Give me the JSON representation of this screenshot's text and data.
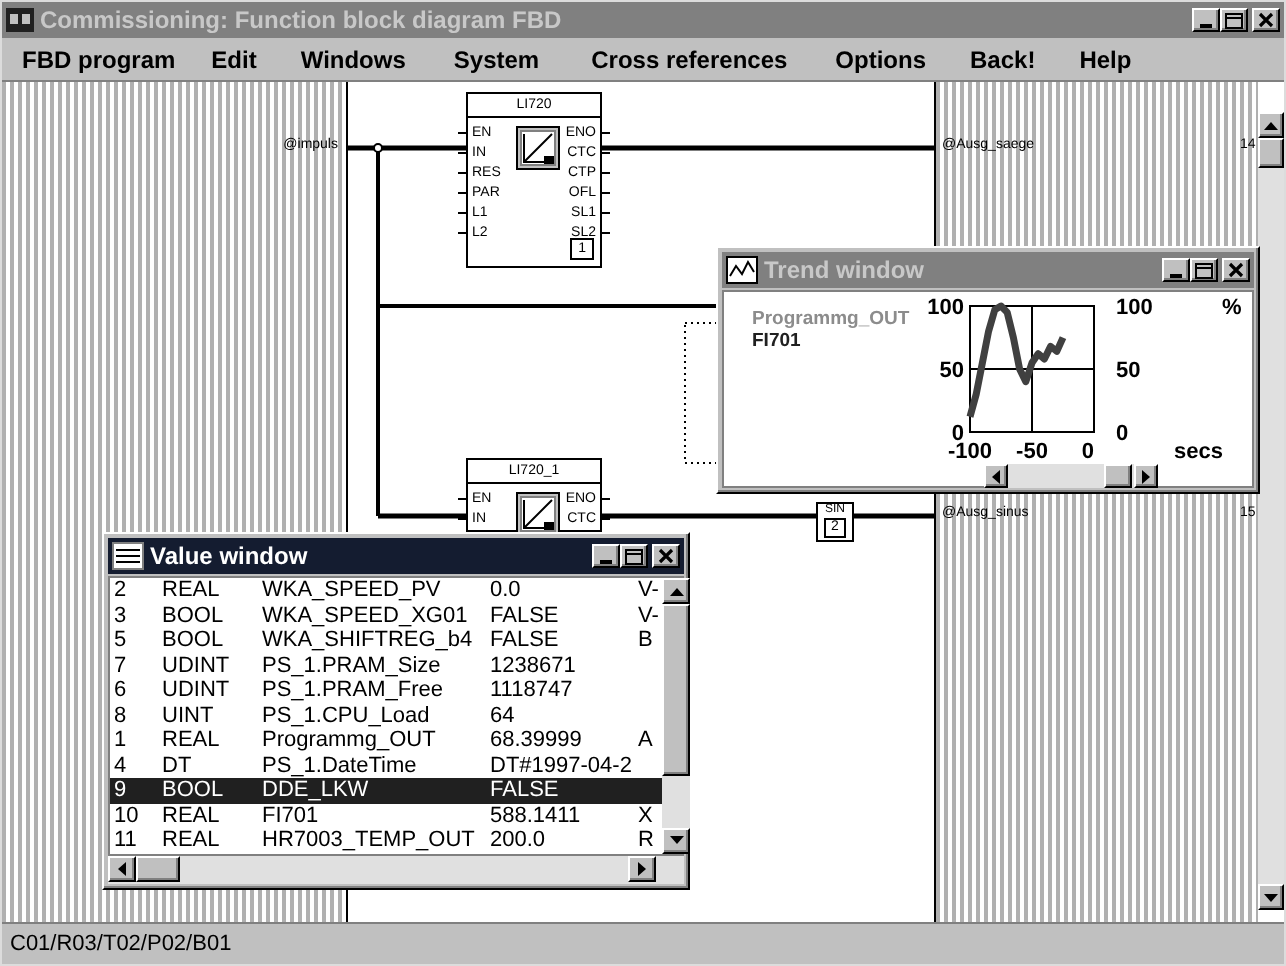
{
  "window": {
    "title": "Commissioning: Function block diagram FBD",
    "active": false
  },
  "menu": [
    {
      "label": "FBD program"
    },
    {
      "label": "Edit"
    },
    {
      "label": "Windows"
    },
    {
      "label": "System"
    },
    {
      "label": "Cross references"
    },
    {
      "label": "Options"
    },
    {
      "label": "Back!"
    },
    {
      "label": "Help"
    }
  ],
  "input_labels": [
    {
      "text": "@impuls"
    }
  ],
  "output_labels": [
    {
      "text": "@Ausg_saege",
      "number": "14"
    },
    {
      "text": "@Ausg_sinus",
      "number": "15"
    }
  ],
  "blocks": [
    {
      "title": "LI720",
      "inputs": [
        "EN",
        "IN",
        "RES",
        "PAR",
        "L1",
        "L2"
      ],
      "outputs": [
        "ENO",
        "CTC",
        "CTP",
        "OFL",
        "SL1",
        "SL2"
      ],
      "index": "1"
    },
    {
      "title": "LI720_1",
      "inputs": [
        "EN",
        "IN"
      ],
      "outputs": [
        "ENO",
        "CTC"
      ]
    }
  ],
  "sin_block": {
    "title": "SIN",
    "index": "2"
  },
  "trend_window": {
    "title": "Trend window",
    "active": false,
    "legend": [
      {
        "label": "Programmg_OUT",
        "dimmed": true
      },
      {
        "label": "FI701",
        "dimmed": false
      }
    ],
    "right_axis": {
      "ticks": [
        "100",
        "50",
        "0"
      ],
      "unit": "%"
    },
    "x_unit": "secs",
    "chart_data": {
      "type": "line",
      "x": [
        -100,
        -95,
        -90,
        -85,
        -80,
        -75,
        -70,
        -65,
        -60,
        -55,
        -50,
        -45,
        -40,
        -35,
        -30,
        -25
      ],
      "series": [
        {
          "color": "#404040",
          "values": [
            12,
            30,
            55,
            80,
            97,
            100,
            95,
            75,
            50,
            40,
            55,
            62,
            58,
            68,
            64,
            75
          ]
        }
      ],
      "xlim": [
        -100,
        0
      ],
      "ylim": [
        0,
        100
      ],
      "xticks": [
        -100,
        -50,
        0
      ],
      "yticks": [
        0,
        50,
        100
      ]
    }
  },
  "value_window": {
    "title": "Value window",
    "active": true,
    "rows": [
      {
        "index": "2",
        "type": "REAL",
        "name": "WKA_SPEED_PV",
        "value": "0.0",
        "column_5": "V-",
        "selected": false
      },
      {
        "index": "3",
        "type": "BOOL",
        "name": "WKA_SPEED_XG01",
        "value": "FALSE",
        "column_5": "V-",
        "selected": false
      },
      {
        "index": "5",
        "type": "BOOL",
        "name": "WKA_SHIFTREG_b4",
        "value": "FALSE",
        "column_5": "B",
        "selected": false
      },
      {
        "index": "7",
        "type": "UDINT",
        "name": "PS_1.PRAM_Size",
        "value": "1238671",
        "selected": false
      },
      {
        "index": "6",
        "type": "UDINT",
        "name": "PS_1.PRAM_Free",
        "value": "1118747",
        "selected": false
      },
      {
        "index": "8",
        "type": "UINT",
        "name": "PS_1.CPU_Load",
        "value": "64",
        "selected": false
      },
      {
        "index": "1",
        "type": "REAL",
        "name": "Programmg_OUT",
        "value": "68.39999",
        "column_5": "A",
        "selected": false
      },
      {
        "index": "4",
        "type": "DT",
        "name": "PS_1.DateTime",
        "value": "DT#1997-04-2",
        "selected": false
      },
      {
        "index": "9",
        "type": "BOOL",
        "name": "DDE_LKW",
        "value": "FALSE",
        "selected": true
      },
      {
        "index": "10",
        "type": "REAL",
        "name": "FI701",
        "value": "588.1411",
        "column_5": "X",
        "selected": false
      },
      {
        "index": "11",
        "type": "REAL",
        "name": "HR7003_TEMP_OUT",
        "value": "200.0",
        "column_5": "R",
        "selected": false
      }
    ]
  },
  "status_bar": {
    "text": "C01/R03/T02/P02/B01"
  }
}
